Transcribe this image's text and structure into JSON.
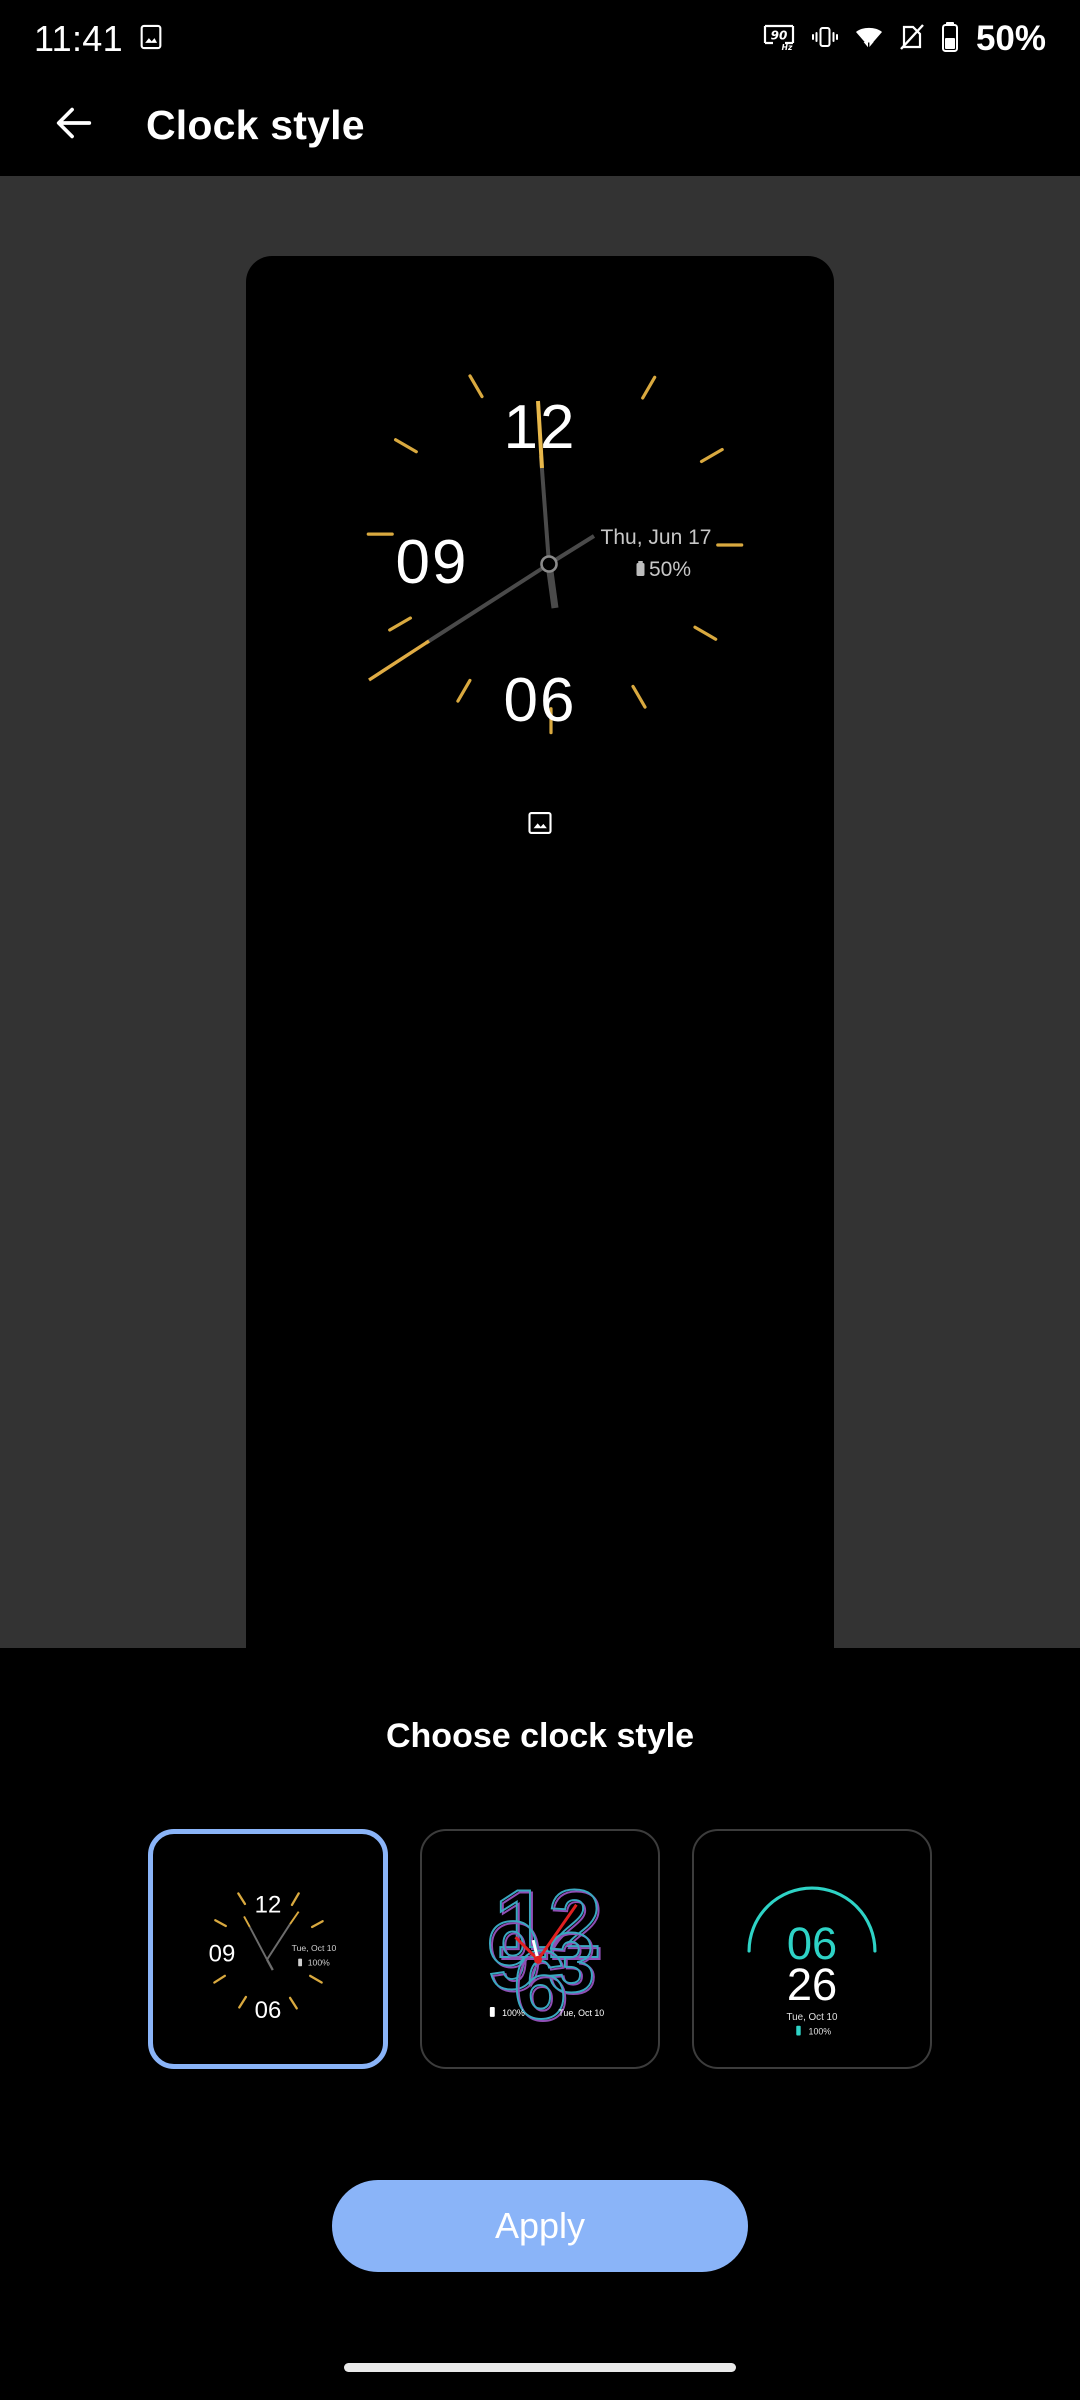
{
  "status_bar": {
    "time": "11:41",
    "left_icons": [
      "photo-icon"
    ],
    "right_icons": [
      "90hz-icon",
      "vibrate-icon",
      "wifi-icon",
      "no-sim-icon",
      "battery-icon"
    ],
    "battery_text": "50%",
    "refresh_rate": "90",
    "refresh_rate_unit": "Hz"
  },
  "header": {
    "back_icon": "arrow-back-icon",
    "title": "Clock style"
  },
  "preview": {
    "clock": {
      "type": "analog",
      "numerals": [
        "12",
        "09",
        "06"
      ],
      "date": "Thu, Jun 17",
      "battery": "50%",
      "tick_color": "#d9a93f",
      "numeral_color": "#ffffff",
      "hand_color": "#4a4a4a",
      "hand_tip_color": "#e8b84b",
      "second_hand_angle_deg": 0,
      "minute_hand_angle_deg": 228,
      "hour_hand_angle_deg": 75,
      "photo_icon": "photo-icon"
    }
  },
  "chooser": {
    "label": "Choose clock style",
    "selected_index": 0,
    "accent_color": "#8ab4f8",
    "styles": [
      {
        "name": "analog-thin-clock",
        "type": "analog",
        "numerals": [
          "12",
          "09",
          "06"
        ],
        "date": "Tue, Oct 10",
        "battery": "100%",
        "selected": true
      },
      {
        "name": "outline-numbers-clock",
        "type": "analog-overlay",
        "numerals": [
          "12",
          "9",
          "6",
          "3"
        ],
        "date": "Tue, Oct 10",
        "battery": "100%",
        "outline_color_a": "#3aa8c1",
        "outline_color_b": "#8f4fb5",
        "hand_color": "#e02020",
        "selected": false
      },
      {
        "name": "digital-arc-clock",
        "type": "digital",
        "hour": "06",
        "minute": "26",
        "date": "Tue, Oct 10",
        "battery": "100%",
        "accent_color": "#2ed3c6",
        "selected": false
      }
    ]
  },
  "apply": {
    "label": "Apply"
  },
  "navigation": {
    "pill": "gesture-nav-pill"
  }
}
